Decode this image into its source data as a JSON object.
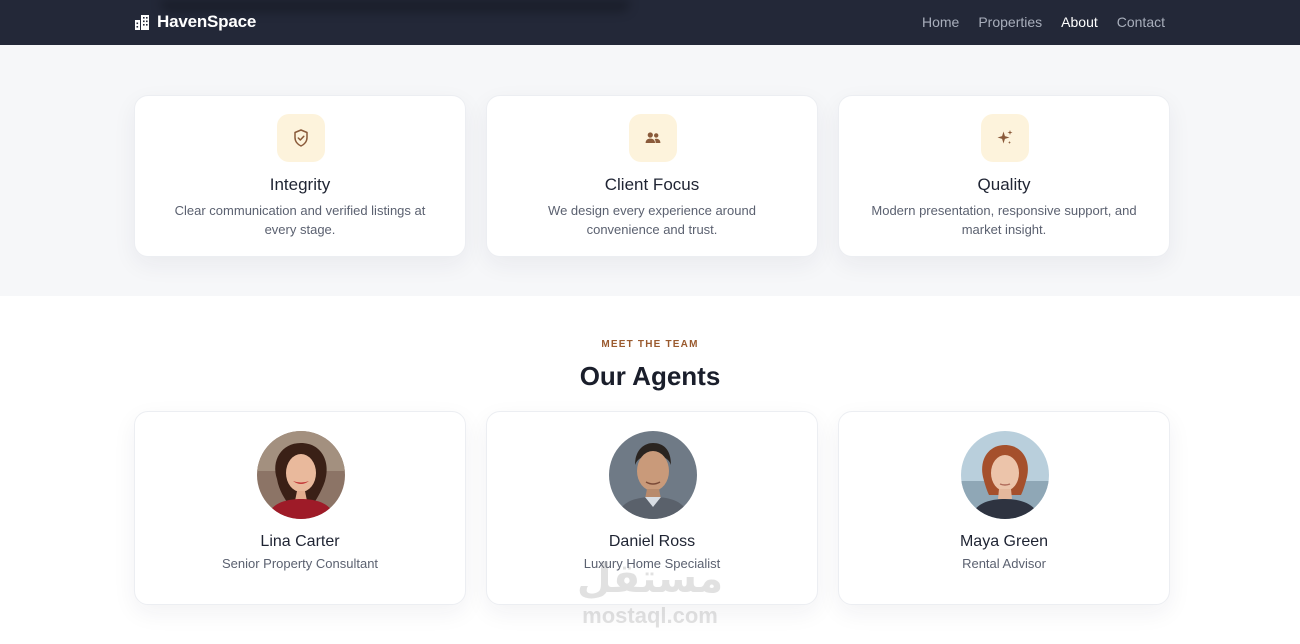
{
  "navbar": {
    "brand": "HavenSpace",
    "brand_icon": "building-icon",
    "links": [
      {
        "label": "Home",
        "active": false
      },
      {
        "label": "Properties",
        "active": false
      },
      {
        "label": "About",
        "active": true
      },
      {
        "label": "Contact",
        "active": false
      }
    ]
  },
  "values": [
    {
      "icon": "shield-check-icon",
      "title": "Integrity",
      "description": "Clear communication and verified listings at every stage."
    },
    {
      "icon": "users-icon",
      "title": "Client Focus",
      "description": "We design every experience around convenience and trust."
    },
    {
      "icon": "sparkle-icon",
      "title": "Quality",
      "description": "Modern presentation, responsive support, and market insight."
    }
  ],
  "team": {
    "eyebrow": "MEET THE TEAM",
    "title": "Our Agents",
    "agents": [
      {
        "name": "Lina Carter",
        "role": "Senior Property Consultant"
      },
      {
        "name": "Daniel Ross",
        "role": "Luxury Home Specialist"
      },
      {
        "name": "Maya Green",
        "role": "Rental Advisor"
      }
    ]
  },
  "watermark": {
    "arabic": "مستقل",
    "latin": "mostaql.com"
  },
  "colors": {
    "navbar_bg": "#232838",
    "accent": "#9a5a2e",
    "icon_bg": "#fdf3dc",
    "section_bg": "#f6f7f9"
  }
}
